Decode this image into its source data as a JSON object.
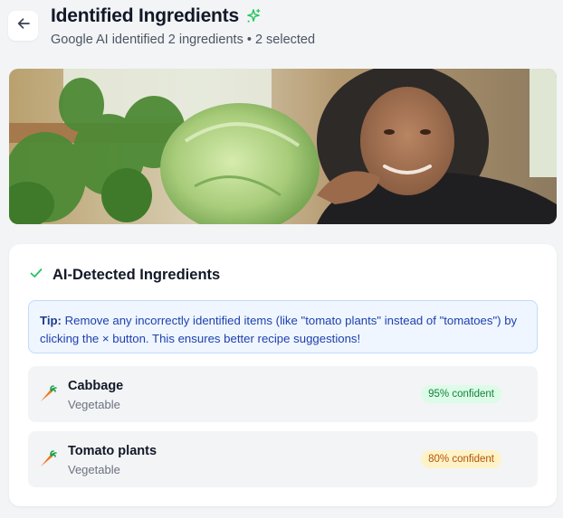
{
  "header": {
    "back_icon": "arrow-left-icon",
    "title": "Identified Ingredients",
    "title_icon": "sparkles-icon",
    "subtitle": "Google AI identified 2 ingredients • 2 selected"
  },
  "photo": {
    "alt": "Woman smiling beside a head of cabbage and tomato plants"
  },
  "card": {
    "title_icon": "check-icon",
    "title": "AI-Detected Ingredients",
    "tip_label": "Tip:",
    "tip_text": " Remove any incorrectly identified items (like \"tomato plants\" instead of \"tomatoes\") by clicking the × button. This ensures better recipe suggestions!"
  },
  "ingredients": [
    {
      "name": "Cabbage",
      "category": "Vegetable",
      "confidence": "95% confident",
      "icon": "carrot-icon",
      "status_color": "#15803d"
    },
    {
      "name": "Tomato plants",
      "category": "Vegetable",
      "confidence": "80% confident",
      "icon": "carrot-icon",
      "status_color": "#b45309"
    }
  ],
  "colors": {
    "accent_green": "#22c55e",
    "tip_background": "#eff6ff",
    "tip_text": "#1e40af"
  }
}
